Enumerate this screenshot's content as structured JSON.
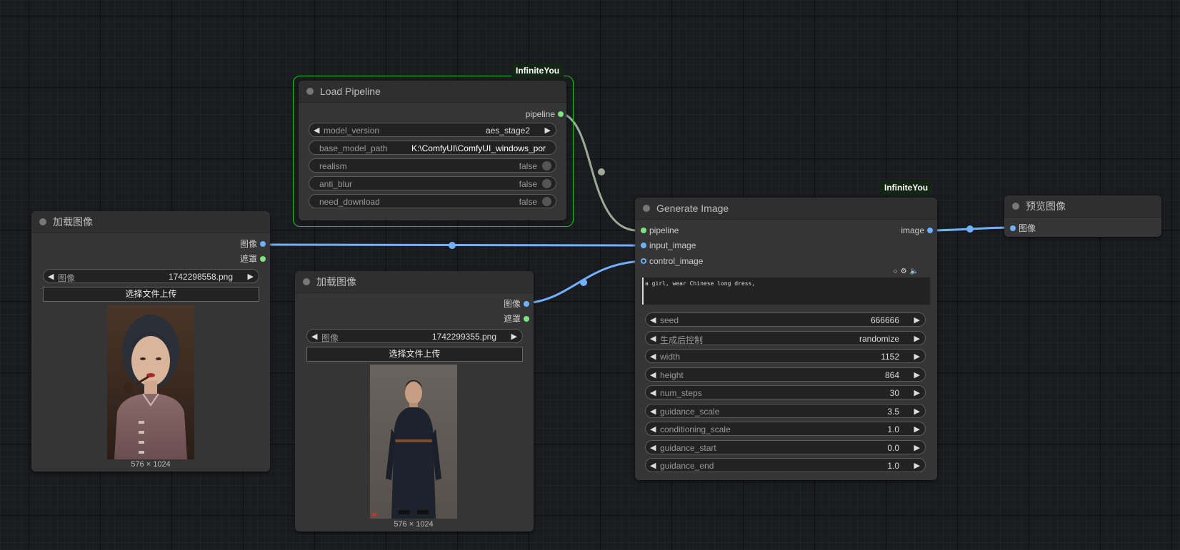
{
  "colors": {
    "canvas": "#191b1f",
    "node_bg": "#353535",
    "link_blue": "#6fb1ff",
    "link_pipeline": "#9aaa96",
    "group_outline": "#21c121",
    "slot_green": "#7ee37e"
  },
  "load_pipeline": {
    "badge": "InfiniteYou",
    "title": "Load Pipeline",
    "output_pipeline": "pipeline",
    "widgets": {
      "model_version_label": "model_version",
      "model_version_value": "aes_stage2",
      "base_model_path_label": "base_model_path",
      "base_model_path_value": "K:\\ComfyUI\\ComfyUI_windows_por",
      "realism_label": "realism",
      "realism_value": "false",
      "anti_blur_label": "anti_blur",
      "anti_blur_value": "false",
      "need_download_label": "need_download",
      "need_download_value": "false"
    }
  },
  "load_image_1": {
    "title": "加载图像",
    "output_image": "图像",
    "output_mask": "遮罩",
    "image_label": "图像",
    "image_value": "1742298558.png",
    "upload_label": "选择文件上传",
    "size_caption": "576 × 1024"
  },
  "load_image_2": {
    "title": "加载图像",
    "output_image": "图像",
    "output_mask": "遮罩",
    "image_label": "图像",
    "image_value": "1742299355.png",
    "upload_label": "选择文件上传",
    "size_caption": "576 × 1024"
  },
  "generate_image": {
    "badge": "InfiniteYou",
    "title": "Generate Image",
    "inputs": [
      "pipeline",
      "input_image",
      "control_image"
    ],
    "output_image": "image",
    "prompt": "a girl, wear Chinese long dress,",
    "params": [
      {
        "label": "seed",
        "value": "666666"
      },
      {
        "label": "生成后控制",
        "value": "randomize"
      },
      {
        "label": "width",
        "value": "1152"
      },
      {
        "label": "height",
        "value": "864"
      },
      {
        "label": "num_steps",
        "value": "30"
      },
      {
        "label": "guidance_scale",
        "value": "3.5"
      },
      {
        "label": "conditioning_scale",
        "value": "1.0"
      },
      {
        "label": "guidance_start",
        "value": "0.0"
      },
      {
        "label": "guidance_end",
        "value": "1.0"
      }
    ]
  },
  "preview_image": {
    "title": "预览图像",
    "input_image": "图像"
  }
}
